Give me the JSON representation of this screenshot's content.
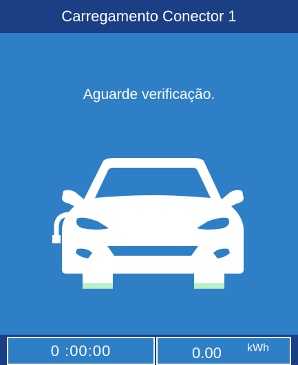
{
  "header": {
    "title": "Carregamento Conector 1"
  },
  "status": {
    "message": "Aguarde verificação."
  },
  "car_illustration": {
    "icon": "car-front-with-charging-cable-icon",
    "accent_color": "#b8f0c8"
  },
  "footer": {
    "elapsed_time": "0 :00:00",
    "energy_value": "0.00",
    "energy_unit": "kWh"
  },
  "colors": {
    "header_bg": "#1b3f85",
    "screen_bg": "#2f7fc7",
    "text": "#ffffff"
  }
}
